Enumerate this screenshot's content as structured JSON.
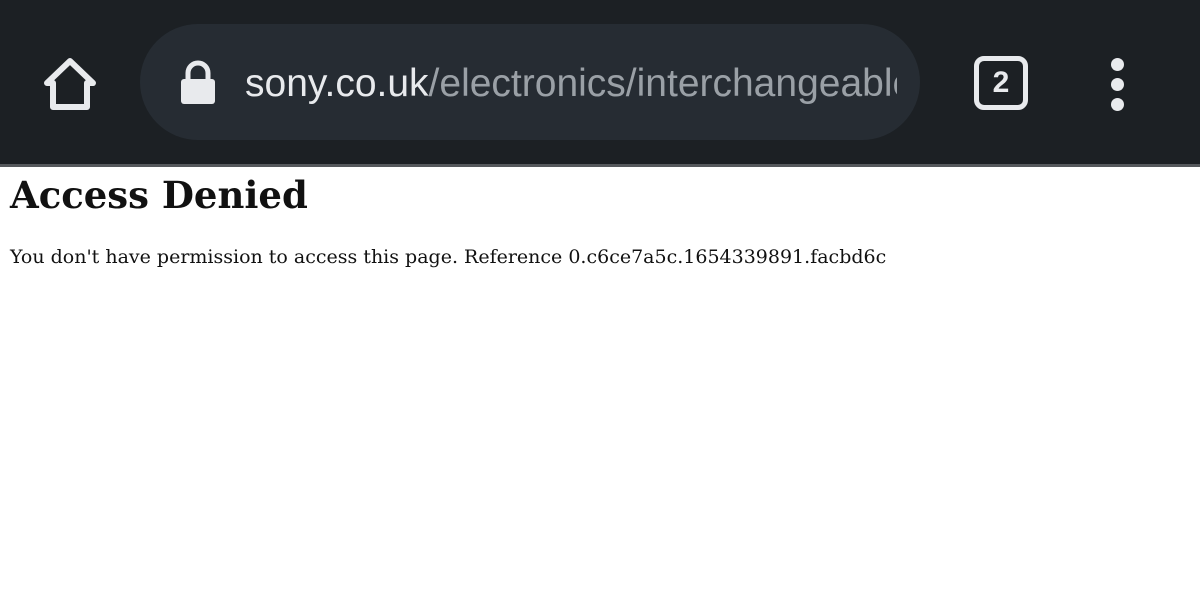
{
  "browser": {
    "url_domain": "sony.co.uk",
    "url_path": "/electronics/interchangeable",
    "tab_count": "2",
    "icons": {
      "home": "home-icon",
      "lock": "lock-icon",
      "tabs": "tab-switcher-icon",
      "menu": "more-vert-icon"
    },
    "colors": {
      "toolbar": "#1c2024",
      "address_bar": "#262c33",
      "url_domain": "#e8eaed",
      "url_path": "#9aa0a6"
    }
  },
  "page": {
    "title": "Access Denied",
    "message": "You don't have permission to access this page. Reference 0.c6ce7a5c.1654339891.facbd6c"
  }
}
